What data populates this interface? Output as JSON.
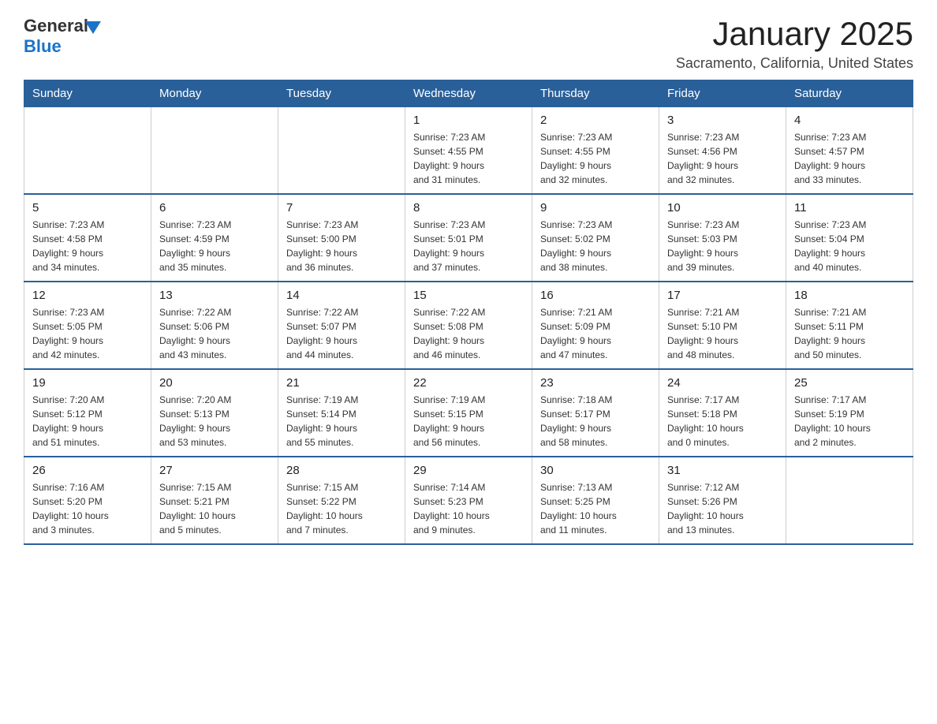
{
  "header": {
    "logo": {
      "general": "General",
      "blue": "Blue"
    },
    "title": "January 2025",
    "subtitle": "Sacramento, California, United States"
  },
  "days_of_week": [
    "Sunday",
    "Monday",
    "Tuesday",
    "Wednesday",
    "Thursday",
    "Friday",
    "Saturday"
  ],
  "weeks": [
    [
      {
        "day": "",
        "info": ""
      },
      {
        "day": "",
        "info": ""
      },
      {
        "day": "",
        "info": ""
      },
      {
        "day": "1",
        "info": "Sunrise: 7:23 AM\nSunset: 4:55 PM\nDaylight: 9 hours\nand 31 minutes."
      },
      {
        "day": "2",
        "info": "Sunrise: 7:23 AM\nSunset: 4:55 PM\nDaylight: 9 hours\nand 32 minutes."
      },
      {
        "day": "3",
        "info": "Sunrise: 7:23 AM\nSunset: 4:56 PM\nDaylight: 9 hours\nand 32 minutes."
      },
      {
        "day": "4",
        "info": "Sunrise: 7:23 AM\nSunset: 4:57 PM\nDaylight: 9 hours\nand 33 minutes."
      }
    ],
    [
      {
        "day": "5",
        "info": "Sunrise: 7:23 AM\nSunset: 4:58 PM\nDaylight: 9 hours\nand 34 minutes."
      },
      {
        "day": "6",
        "info": "Sunrise: 7:23 AM\nSunset: 4:59 PM\nDaylight: 9 hours\nand 35 minutes."
      },
      {
        "day": "7",
        "info": "Sunrise: 7:23 AM\nSunset: 5:00 PM\nDaylight: 9 hours\nand 36 minutes."
      },
      {
        "day": "8",
        "info": "Sunrise: 7:23 AM\nSunset: 5:01 PM\nDaylight: 9 hours\nand 37 minutes."
      },
      {
        "day": "9",
        "info": "Sunrise: 7:23 AM\nSunset: 5:02 PM\nDaylight: 9 hours\nand 38 minutes."
      },
      {
        "day": "10",
        "info": "Sunrise: 7:23 AM\nSunset: 5:03 PM\nDaylight: 9 hours\nand 39 minutes."
      },
      {
        "day": "11",
        "info": "Sunrise: 7:23 AM\nSunset: 5:04 PM\nDaylight: 9 hours\nand 40 minutes."
      }
    ],
    [
      {
        "day": "12",
        "info": "Sunrise: 7:23 AM\nSunset: 5:05 PM\nDaylight: 9 hours\nand 42 minutes."
      },
      {
        "day": "13",
        "info": "Sunrise: 7:22 AM\nSunset: 5:06 PM\nDaylight: 9 hours\nand 43 minutes."
      },
      {
        "day": "14",
        "info": "Sunrise: 7:22 AM\nSunset: 5:07 PM\nDaylight: 9 hours\nand 44 minutes."
      },
      {
        "day": "15",
        "info": "Sunrise: 7:22 AM\nSunset: 5:08 PM\nDaylight: 9 hours\nand 46 minutes."
      },
      {
        "day": "16",
        "info": "Sunrise: 7:21 AM\nSunset: 5:09 PM\nDaylight: 9 hours\nand 47 minutes."
      },
      {
        "day": "17",
        "info": "Sunrise: 7:21 AM\nSunset: 5:10 PM\nDaylight: 9 hours\nand 48 minutes."
      },
      {
        "day": "18",
        "info": "Sunrise: 7:21 AM\nSunset: 5:11 PM\nDaylight: 9 hours\nand 50 minutes."
      }
    ],
    [
      {
        "day": "19",
        "info": "Sunrise: 7:20 AM\nSunset: 5:12 PM\nDaylight: 9 hours\nand 51 minutes."
      },
      {
        "day": "20",
        "info": "Sunrise: 7:20 AM\nSunset: 5:13 PM\nDaylight: 9 hours\nand 53 minutes."
      },
      {
        "day": "21",
        "info": "Sunrise: 7:19 AM\nSunset: 5:14 PM\nDaylight: 9 hours\nand 55 minutes."
      },
      {
        "day": "22",
        "info": "Sunrise: 7:19 AM\nSunset: 5:15 PM\nDaylight: 9 hours\nand 56 minutes."
      },
      {
        "day": "23",
        "info": "Sunrise: 7:18 AM\nSunset: 5:17 PM\nDaylight: 9 hours\nand 58 minutes."
      },
      {
        "day": "24",
        "info": "Sunrise: 7:17 AM\nSunset: 5:18 PM\nDaylight: 10 hours\nand 0 minutes."
      },
      {
        "day": "25",
        "info": "Sunrise: 7:17 AM\nSunset: 5:19 PM\nDaylight: 10 hours\nand 2 minutes."
      }
    ],
    [
      {
        "day": "26",
        "info": "Sunrise: 7:16 AM\nSunset: 5:20 PM\nDaylight: 10 hours\nand 3 minutes."
      },
      {
        "day": "27",
        "info": "Sunrise: 7:15 AM\nSunset: 5:21 PM\nDaylight: 10 hours\nand 5 minutes."
      },
      {
        "day": "28",
        "info": "Sunrise: 7:15 AM\nSunset: 5:22 PM\nDaylight: 10 hours\nand 7 minutes."
      },
      {
        "day": "29",
        "info": "Sunrise: 7:14 AM\nSunset: 5:23 PM\nDaylight: 10 hours\nand 9 minutes."
      },
      {
        "day": "30",
        "info": "Sunrise: 7:13 AM\nSunset: 5:25 PM\nDaylight: 10 hours\nand 11 minutes."
      },
      {
        "day": "31",
        "info": "Sunrise: 7:12 AM\nSunset: 5:26 PM\nDaylight: 10 hours\nand 13 minutes."
      },
      {
        "day": "",
        "info": ""
      }
    ]
  ]
}
